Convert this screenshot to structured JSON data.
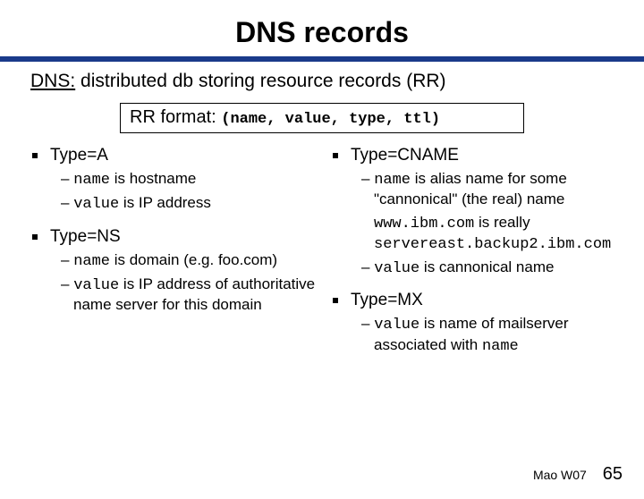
{
  "title": "DNS records",
  "subtitle_u": "DNS:",
  "subtitle_rest": " distributed db storing resource records (RR)",
  "rrformat_label": "RR format: ",
  "rrformat_tuple": "(name, value, type, ttl)",
  "left": {
    "a": {
      "heading": "Type=A",
      "l1a": "– ",
      "l1b": "name",
      "l1c": " is hostname",
      "l2a": "– ",
      "l2b": "value",
      "l2c": " is IP address"
    },
    "ns": {
      "heading": "Type=NS",
      "l1a": "– ",
      "l1b": "name",
      "l1c": " is domain (e.g. foo.com)",
      "l2a": "– ",
      "l2b": "value",
      "l2c": " is IP address of authoritative name server for this domain"
    }
  },
  "right": {
    "cname": {
      "heading": "Type=CNAME",
      "l1a": "– ",
      "l1b": "name",
      "l1c": " is alias name for some \"cannonical\" (the real) name",
      "l2a": "www.ibm.com",
      "l2b": " is really ",
      "l2c": "servereast.backup2.ibm.com",
      "l3a": "– ",
      "l3b": "value",
      "l3c": " is cannonical name"
    },
    "mx": {
      "heading": "Type=MX",
      "l1a": "– ",
      "l1b": "value",
      "l1c": " is name of mailserver associated with ",
      "l1d": "name"
    }
  },
  "footer_label": "Mao W07",
  "page_number": "65"
}
